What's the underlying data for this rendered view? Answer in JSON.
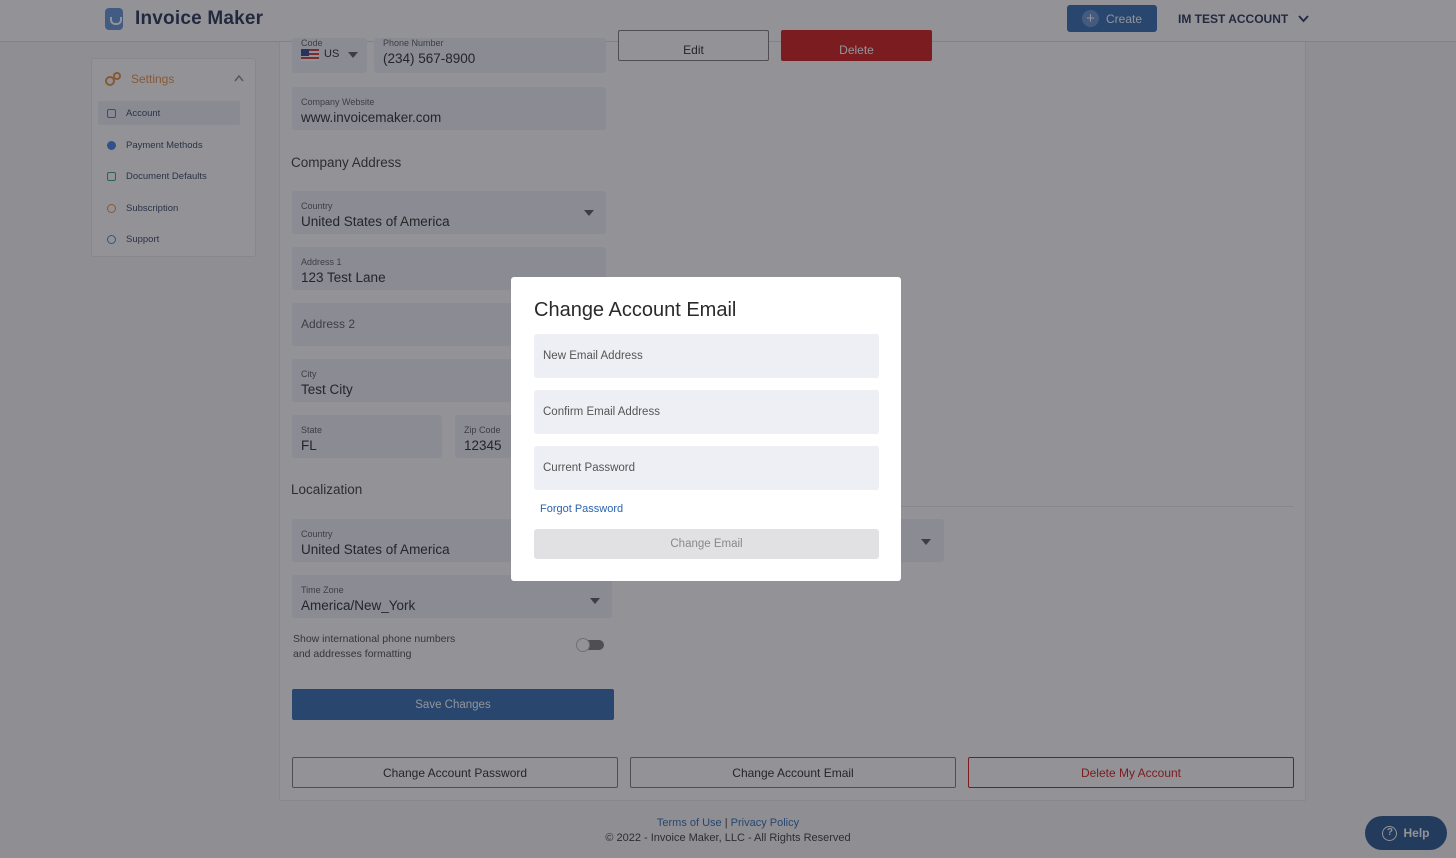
{
  "header": {
    "app_name": "Invoice Maker",
    "create_label": "Create",
    "account_label": "IM TEST ACCOUNT"
  },
  "sidebar": {
    "title": "Settings",
    "items": [
      {
        "label": "Account",
        "icon": "account-icon",
        "color": "#4a6fbf"
      },
      {
        "label": "Payment Methods",
        "icon": "payment-icon",
        "color": "#3f7be0"
      },
      {
        "label": "Document Defaults",
        "icon": "document-icon",
        "color": "#2aa36a"
      },
      {
        "label": "Subscription",
        "icon": "subscription-icon",
        "color": "#e58b3a"
      },
      {
        "label": "Support",
        "icon": "support-icon",
        "color": "#3f7be0"
      }
    ]
  },
  "form": {
    "code_label": "Code",
    "code_value": "US",
    "phone_label": "Phone Number",
    "phone_value": "(234) 567-8900",
    "edit_label": "Edit",
    "delete_label": "Delete",
    "website_label": "Company Website",
    "website_value": "www.invoicemaker.com",
    "company_address_title": "Company Address",
    "country_label": "Country",
    "country_value": "United States of America",
    "address1_label": "Address 1",
    "address1_value": "123 Test Lane",
    "address2_placeholder": "Address 2",
    "city_label": "City",
    "city_value": "Test City",
    "state_label": "State",
    "state_value": "FL",
    "zip_label": "Zip Code",
    "zip_value": "12345",
    "localization_title": "Localization",
    "loc_country_label": "Country",
    "loc_country_value": "United States of America",
    "timezone_label": "Time Zone",
    "timezone_value": "America/New_York",
    "intl_toggle_text_1": "Show international phone numbers",
    "intl_toggle_text_2": "and addresses formatting",
    "save_label": "Save Changes",
    "change_password_label": "Change Account Password",
    "change_email_label": "Change Account Email",
    "delete_account_label": "Delete My Account"
  },
  "footer": {
    "terms": "Terms of Use",
    "separator": "|",
    "privacy": "Privacy Policy",
    "copyright": "© 2022 - Invoice Maker, LLC - All Rights Reserved"
  },
  "help_label": "Help",
  "modal": {
    "title": "Change Account Email",
    "new_email_placeholder": "New Email Address",
    "confirm_email_placeholder": "Confirm Email Address",
    "password_placeholder": "Current Password",
    "forgot_label": "Forgot Password",
    "submit_label": "Change Email"
  },
  "colors": {
    "brand": "#2a64ae",
    "danger": "#cc1111",
    "settings_accent": "#e58b3a"
  }
}
